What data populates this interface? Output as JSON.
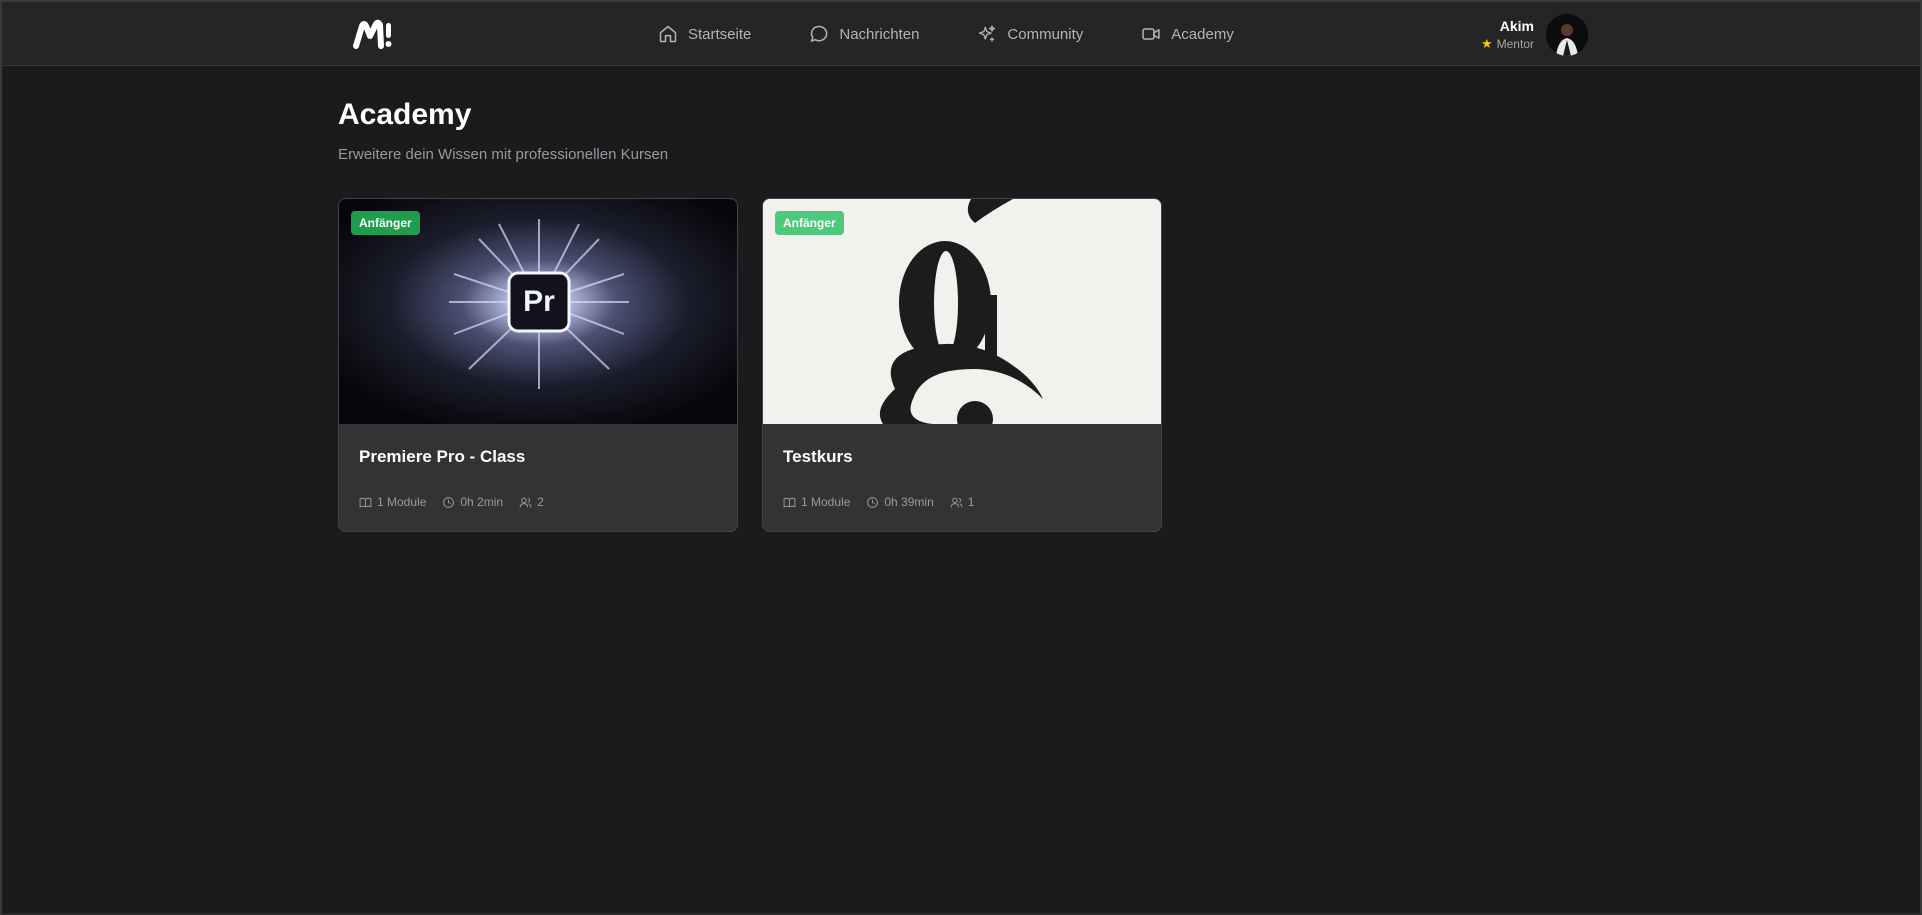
{
  "nav": {
    "logo_text": "M!",
    "items": [
      {
        "label": "Startseite",
        "icon": "home-icon"
      },
      {
        "label": "Nachrichten",
        "icon": "chat-bubble-icon"
      },
      {
        "label": "Community",
        "icon": "sparkles-icon"
      },
      {
        "label": "Academy",
        "icon": "video-camera-icon"
      }
    ]
  },
  "user": {
    "name": "Akim",
    "role": "Mentor",
    "role_icon": "star-icon"
  },
  "page": {
    "title": "Academy",
    "subtitle": "Erweitere dein Wissen mit professionellen Kursen"
  },
  "courses": [
    {
      "title": "Premiere Pro - Class",
      "level": "Anfänger",
      "level_color": "#1f9d4c",
      "thumbnail_text": "Pr",
      "modules": "1 Module",
      "duration": "0h 2min",
      "participants": "2"
    },
    {
      "title": "Testkurs",
      "level": "Anfänger",
      "level_color": "#4cc97a",
      "thumbnail_text": "g",
      "modules": "1 Module",
      "duration": "0h 39min",
      "participants": "1"
    }
  ],
  "colors": {
    "background": "#1b1b1d",
    "topbar": "#252527",
    "card": "#333336",
    "muted_text": "#98989d"
  }
}
